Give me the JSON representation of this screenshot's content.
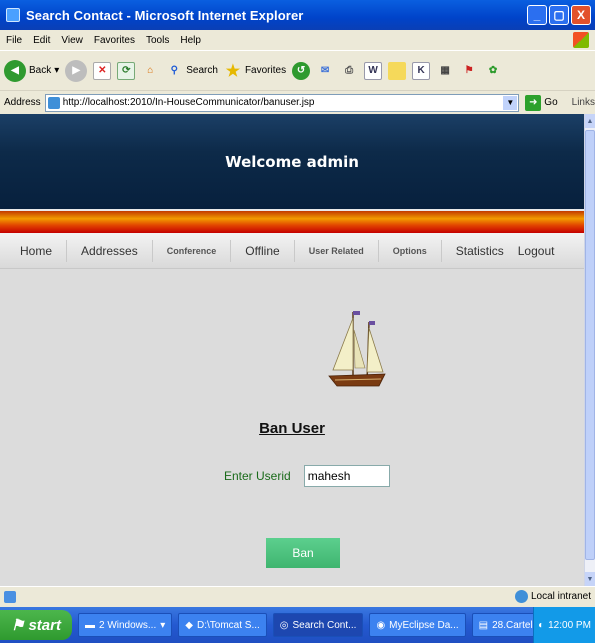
{
  "window": {
    "title": "Search Contact - Microsoft Internet Explorer",
    "buttons": [
      "_",
      "▢",
      "X"
    ]
  },
  "menu": [
    "File",
    "Edit",
    "View",
    "Favorites",
    "Tools",
    "Help"
  ],
  "toolbar": {
    "back": "Back",
    "search": "Search",
    "favorites": "Favorites"
  },
  "address": {
    "label": "Address",
    "url": "http://localhost:2010/In-HouseCommunicator/banuser.jsp",
    "go": "Go",
    "links": "Links"
  },
  "page": {
    "welcome": "Welcome admin",
    "nav": [
      "Home",
      "Addresses",
      "Conference",
      "Offline",
      "User Related",
      "Options",
      "Statistics",
      "Logout"
    ],
    "heading": "Ban User",
    "field_label": "Enter Userid",
    "field_value": "mahesh",
    "button": "Ban"
  },
  "status": {
    "zone": "Local intranet"
  },
  "taskbar": {
    "start": "start",
    "tasks": [
      "2 Windows...",
      "D:\\Tomcat S...",
      "Search Cont...",
      "MyEclipse Da...",
      "28.Cartel Co..."
    ],
    "clock": "12:00 PM"
  },
  "colors": {
    "header": "#0d2a49",
    "stripe": "#f29b00",
    "ban_button": "#4cc27f",
    "label_green": "#1a6b1a"
  }
}
